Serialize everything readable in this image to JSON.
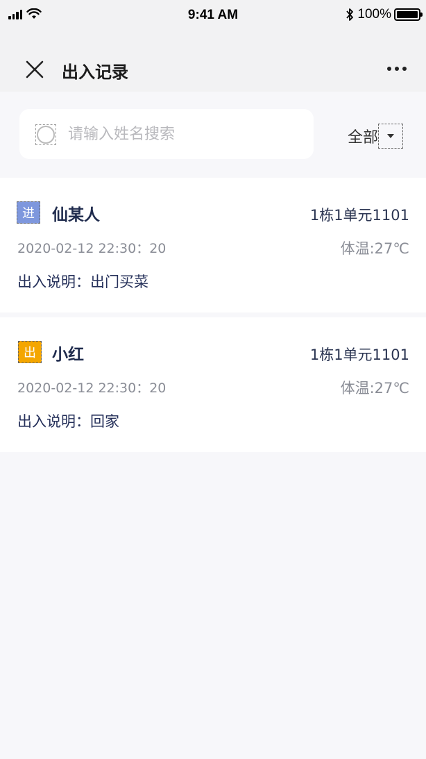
{
  "status_bar": {
    "time": "9:41 AM",
    "battery": "100%"
  },
  "nav": {
    "title": "出入记录",
    "close_icon": "close-icon",
    "more_icon": "more-icon"
  },
  "search": {
    "placeholder": "请输入姓名搜索",
    "value": "",
    "filter_label": "全部"
  },
  "records": [
    {
      "badge": "进",
      "badge_color": "#7e97dd",
      "name": "仙某人",
      "unit": "1栋1单元1101",
      "time": "2020-02-12 22:30：20",
      "temperature": "体温:27℃",
      "description": "出入说明：出门买菜"
    },
    {
      "badge": "出",
      "badge_color": "#f4a600",
      "name": "小红",
      "unit": "1栋1单元1101",
      "time": "2020-02-12 22:30：20",
      "temperature": "体温:27℃",
      "description": "出入说明：回家"
    }
  ]
}
